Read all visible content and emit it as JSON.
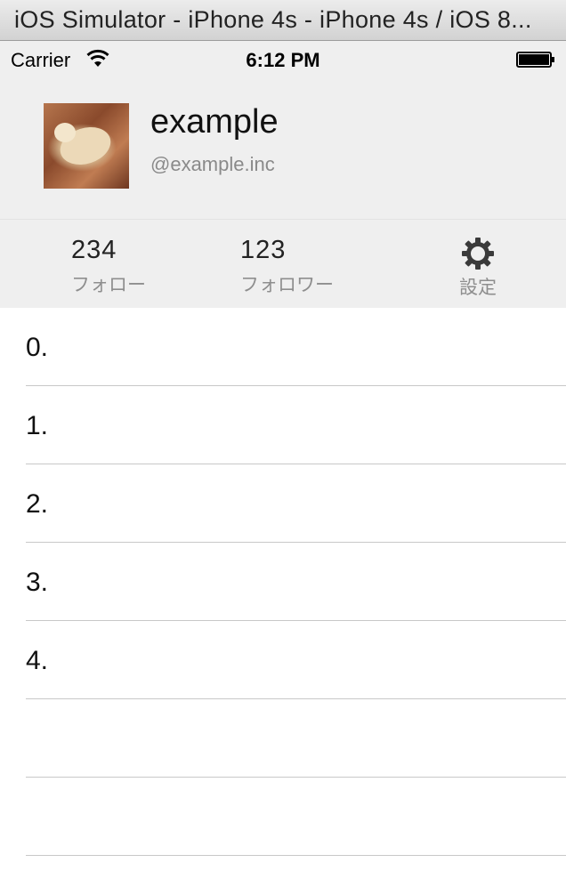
{
  "window": {
    "title": "iOS Simulator - iPhone 4s - iPhone 4s / iOS 8..."
  },
  "status_bar": {
    "carrier": "Carrier",
    "time": "6:12 PM",
    "wifi_icon": "wifi-icon",
    "battery_icon": "battery-icon"
  },
  "profile": {
    "name": "example",
    "handle": "@example.inc",
    "avatar": "cat-photo-avatar"
  },
  "stats": {
    "follow": {
      "count": "234",
      "label": "フォロー"
    },
    "follower": {
      "count": "123",
      "label": "フォロワー"
    },
    "settings": {
      "label": "設定",
      "icon": "gear-icon"
    }
  },
  "list": {
    "rows": [
      "0.",
      "1.",
      "2.",
      "3.",
      "4.",
      "",
      "",
      ""
    ]
  },
  "colors": {
    "header_bg": "#efefef",
    "separator": "#c8c8c8",
    "secondary_text": "#8e8e8e"
  }
}
